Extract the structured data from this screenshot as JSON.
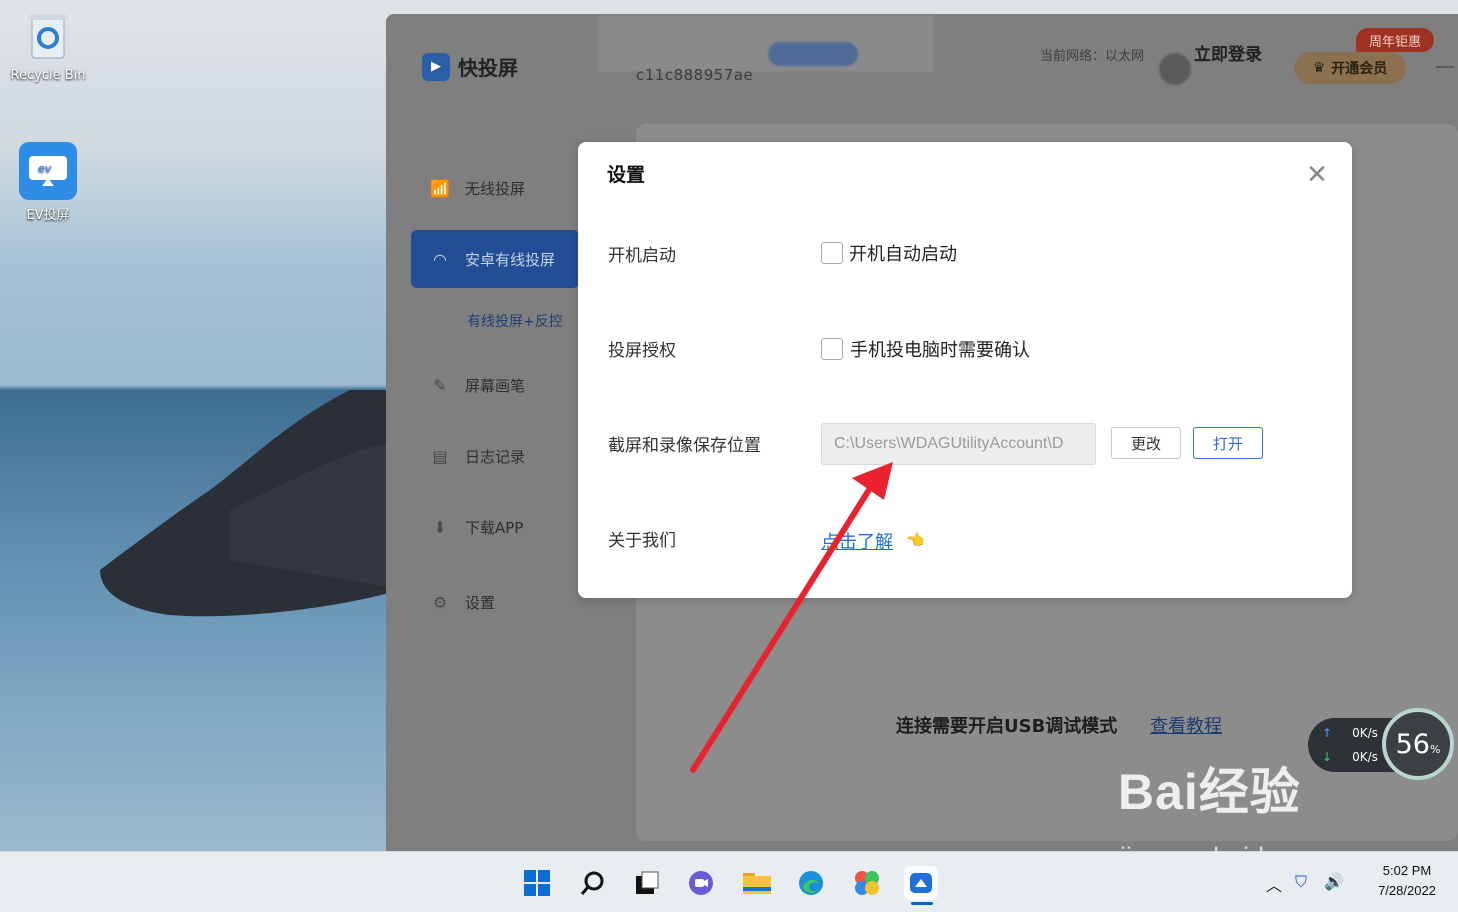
{
  "desktop": {
    "icons": [
      {
        "label": "Recycle Bin",
        "icon": "recycle-bin-icon"
      },
      {
        "label": "EV投屏",
        "icon": "ev-cast-icon"
      }
    ]
  },
  "app": {
    "name": "快投屏",
    "device_id": "c11c888957ae",
    "network": "当前网络：以太网",
    "login": "立即登录",
    "vip_button": "开通会员",
    "promo_badge": "周年钜惠",
    "nav": [
      {
        "label": "无线投屏",
        "icon": "wireless-cast-icon"
      },
      {
        "label": "安卓有线投屏",
        "icon": "android-icon",
        "active": true
      },
      {
        "label": "屏幕画笔",
        "icon": "pen-icon"
      },
      {
        "label": "日志记录",
        "icon": "log-icon"
      },
      {
        "label": "下载APP",
        "icon": "download-icon"
      },
      {
        "label": "设置",
        "icon": "gear-icon"
      }
    ],
    "subnav_label": "有线投屏+反控",
    "usb_hint": "连接需要开启USB调试模式",
    "tutorial_link": "查看教程"
  },
  "dialog": {
    "title": "设置",
    "rows": {
      "startup": {
        "label": "开机启动",
        "checkbox_label": "开机自动启动",
        "checked": false
      },
      "auth": {
        "label": "投屏授权",
        "checkbox_label": "手机投电脑时需要确认",
        "checked": false
      },
      "save_path": {
        "label": "截屏和录像保存位置",
        "value": "C:\\Users\\WDAGUtilityAccount\\D",
        "change_button": "更改",
        "open_button": "打开"
      },
      "about": {
        "label": "关于我们",
        "link": "点击了解"
      }
    }
  },
  "netmon": {
    "up": "0K/s",
    "down": "0K/s",
    "percent": "56",
    "percent_unit": "%"
  },
  "watermark": {
    "brand": "Bai经验",
    "url": "jingyan.baidu.com"
  },
  "taskbar": {
    "icons": [
      "windows-start-icon",
      "search-icon",
      "task-view-icon",
      "chat-icon",
      "file-explorer-icon",
      "edge-icon",
      "photos-icon",
      "cast-app-icon"
    ],
    "time": "5:02 PM",
    "date": "7/28/2022"
  },
  "colors": {
    "accent": "#2f6fd0",
    "annotation_arrow": "#e8232f",
    "nav_active": "#214e95"
  }
}
